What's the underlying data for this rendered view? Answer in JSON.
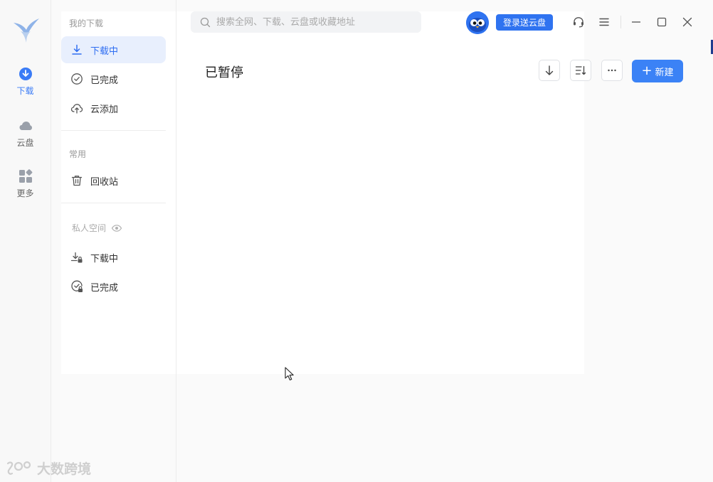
{
  "rail": {
    "items": [
      {
        "label": "下载",
        "icon": "download-circle-icon",
        "active": true
      },
      {
        "label": "云盘",
        "icon": "cloud-icon",
        "active": false
      },
      {
        "label": "更多",
        "icon": "apps-grid-icon",
        "active": false
      }
    ]
  },
  "nav": {
    "section_downloads": "我的下载",
    "downloading": "下载中",
    "completed": "已完成",
    "cloud_add": "云添加",
    "section_common": "常用",
    "recycle": "回收站",
    "section_private": "私人空间",
    "private_downloading": "下载中",
    "private_completed": "已完成"
  },
  "search": {
    "placeholder": "搜索全网、下载、云盘或收藏地址"
  },
  "header": {
    "login_label": "登录送云盘"
  },
  "main": {
    "title": "已暂停",
    "new_label": "新建"
  },
  "watermark": {
    "text": "大数跨境"
  },
  "colors": {
    "accent": "#3b82f6",
    "active_bg": "#e8effd"
  }
}
